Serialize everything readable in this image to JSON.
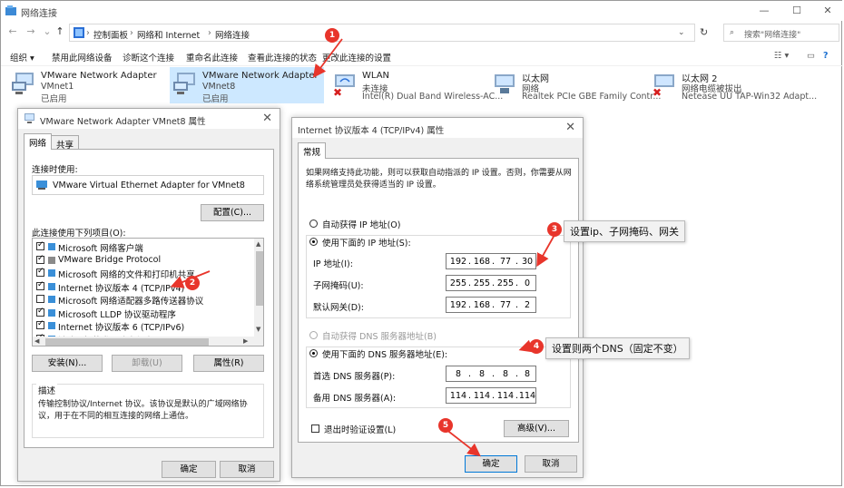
{
  "window": {
    "title": "网络连接"
  },
  "address": {
    "crumbs": [
      "控制面板",
      "网络和 Internet",
      "网络连接"
    ],
    "search_placeholder": "搜索\"网络连接\""
  },
  "toolbar": {
    "organize": "组织 ▾",
    "items": [
      "禁用此网络设备",
      "诊断这个连接",
      "重命名此连接",
      "查看此连接的状态",
      "更改此连接的设置"
    ]
  },
  "adapters": [
    {
      "name": "VMware Network Adapter",
      "line2": "VMnet1",
      "line3": "已启用"
    },
    {
      "name": "VMware Network Adapter",
      "line2": "VMnet8",
      "line3": "已启用"
    },
    {
      "name": "WLAN",
      "line2": "未连接",
      "line3": "Intel(R) Dual Band Wireless-AC..."
    },
    {
      "name": "以太网",
      "line2": "网络",
      "line3": "Realtek PCIe GBE Family Contr..."
    },
    {
      "name": "以太网 2",
      "line2": "网络电缆被拔出",
      "line3": "Netease UU TAP-Win32 Adapt..."
    }
  ],
  "props": {
    "title": "VMware Network Adapter VMnet8 属性",
    "tabs": [
      "网络",
      "共享"
    ],
    "connect_using": "连接时使用:",
    "adapter_name": "VMware Virtual Ethernet Adapter for VMnet8",
    "configure": "配置(C)...",
    "uses_items": "此连接使用下列项目(O):",
    "items": [
      {
        "label": "Microsoft 网络客户端",
        "checked": true
      },
      {
        "label": "VMware Bridge Protocol",
        "checked": true
      },
      {
        "label": "Microsoft 网络的文件和打印机共享",
        "checked": true
      },
      {
        "label": "Internet 协议版本 4 (TCP/IPv4)",
        "checked": true
      },
      {
        "label": "Microsoft 网络适配器多路传送器协议",
        "checked": false
      },
      {
        "label": "Microsoft LLDP 协议驱动程序",
        "checked": true
      },
      {
        "label": "Internet 协议版本 6 (TCP/IPv6)",
        "checked": true
      },
      {
        "label": "链路层拓扑发现响应程序",
        "checked": true
      }
    ],
    "install": "安装(N)...",
    "uninstall": "卸载(U)",
    "properties": "属性(R)",
    "desc_label": "描述",
    "description": "传输控制协议/Internet 协议。该协议是默认的广域网络协议，用于在不同的相互连接的网络上通信。",
    "ok": "确定",
    "cancel": "取消"
  },
  "ipv4": {
    "title": "Internet 协议版本 4 (TCP/IPv4) 属性",
    "tab": "常规",
    "intro": "如果网络支持此功能，则可以获取自动指派的 IP 设置。否则，你需要从网络系统管理员处获得适当的 IP 设置。",
    "auto_ip": "自动获得 IP 地址(O)",
    "manual_ip": "使用下面的 IP 地址(S):",
    "ip_label": "IP 地址(I):",
    "ip": [
      "192",
      "168",
      "77",
      "30"
    ],
    "mask_label": "子网掩码(U):",
    "mask": [
      "255",
      "255",
      "255",
      "0"
    ],
    "gw_label": "默认网关(D):",
    "gw": [
      "192",
      "168",
      "77",
      "2"
    ],
    "auto_dns": "自动获得 DNS 服务器地址(B)",
    "manual_dns": "使用下面的 DNS 服务器地址(E):",
    "dns1_label": "首选 DNS 服务器(P):",
    "dns1": [
      "8",
      "8",
      "8",
      "8"
    ],
    "dns2_label": "备用 DNS 服务器(A):",
    "dns2": [
      "114",
      "114",
      "114",
      "114"
    ],
    "validate": "退出时验证设置(L)",
    "advanced": "高级(V)...",
    "ok": "确定",
    "cancel": "取消"
  },
  "annotations": {
    "b1": "1",
    "b2": "2",
    "b3": "3",
    "b4": "4",
    "b5": "5",
    "c3": "设置ip、子网掩码、网关",
    "c4": "设置则两个DNS（固定不变）"
  },
  "colors": {
    "selected": "#cde8ff",
    "accent": "#0078d7",
    "annotation": "#e8352b"
  }
}
